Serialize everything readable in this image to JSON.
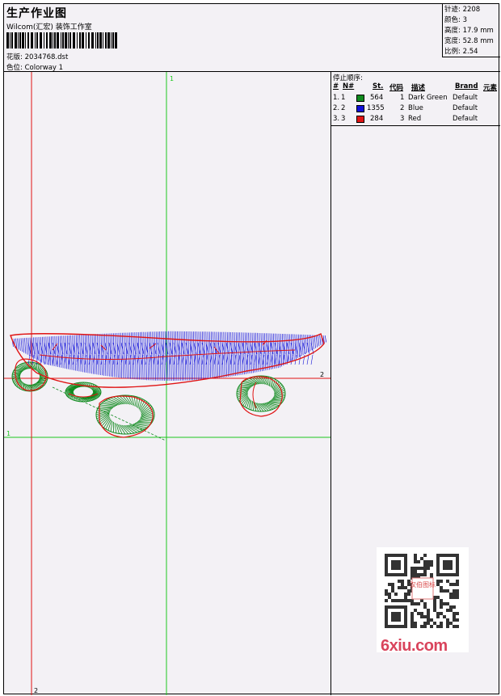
{
  "header": {
    "title": "生产作业图",
    "studio": "Wilcom(汇宏) 装饰工作室",
    "design_label": "花版:",
    "design_value": "2034768.dst",
    "colorway_label": "色位:",
    "colorway_value": "Colorway 1"
  },
  "stats": [
    {
      "label": "针迹:",
      "value": "2208"
    },
    {
      "label": "颜色:",
      "value": "3"
    },
    {
      "label": "高度:",
      "value": "17.9 mm"
    },
    {
      "label": "宽度:",
      "value": "52.8 mm"
    },
    {
      "label": "比例:",
      "value": "2.54"
    }
  ],
  "stop_sequence": {
    "title": "停止顺序:",
    "columns": [
      "#",
      "N#",
      "St.",
      "代码",
      "描述",
      "Brand",
      "元素"
    ],
    "rows": [
      {
        "index": "1.",
        "needle": "1",
        "color": "#0f8a1e",
        "stitches": "564",
        "code": "1",
        "description": "Dark Green",
        "brand": "Default"
      },
      {
        "index": "2.",
        "needle": "2",
        "color": "#1010d8",
        "stitches": "1355",
        "code": "2",
        "description": "Blue",
        "brand": "Default"
      },
      {
        "index": "3.",
        "needle": "3",
        "color": "#e01414",
        "stitches": "284",
        "code": "3",
        "description": "Red",
        "brand": "Default"
      }
    ]
  },
  "guides": {
    "vertical_green_label": "1",
    "horizontal_green_label": "1",
    "vertical_red_label": "2",
    "horizontal_red_label": "2",
    "green_color": "#1ec81e",
    "red_color": "#e01414"
  },
  "watermark": {
    "site": "6xiu.com",
    "qr_center_text": "汉伯图标"
  }
}
